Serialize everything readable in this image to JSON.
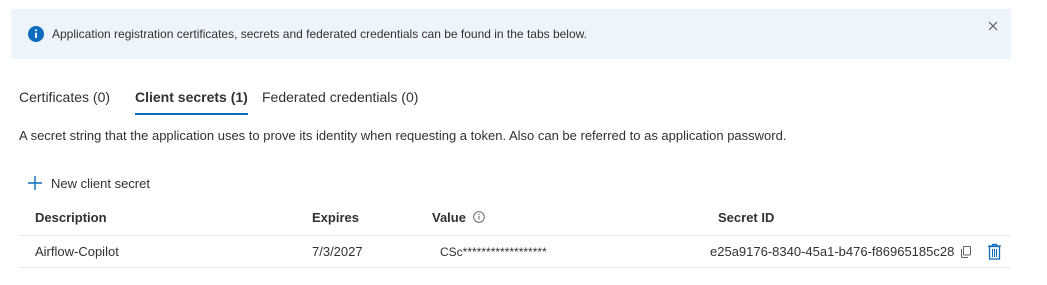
{
  "banner": {
    "message": "Application registration certificates, secrets and federated credentials can be found in the tabs below.",
    "icon": "info-icon",
    "close_icon": "close-icon"
  },
  "tabs": [
    {
      "label": "Certificates (0)",
      "active": false
    },
    {
      "label": "Client secrets (1)",
      "active": true
    },
    {
      "label": "Federated credentials (0)",
      "active": false
    }
  ],
  "description": "A secret string that the application uses to prove its identity when requesting a token. Also can be referred to as application password.",
  "new_secret_label": "New client secret",
  "table": {
    "headers": [
      "Description",
      "Expires",
      "Value",
      "Secret ID"
    ],
    "rows": [
      {
        "description": "Airflow-Copilot",
        "expires": "7/3/2027",
        "value": "CSc******************",
        "secret_id": "e25a9176-8340-45a1-b476-f86965185c28"
      }
    ]
  },
  "colors": {
    "accent": "#0f6cbd",
    "banner_bg": "#eef4fb"
  }
}
